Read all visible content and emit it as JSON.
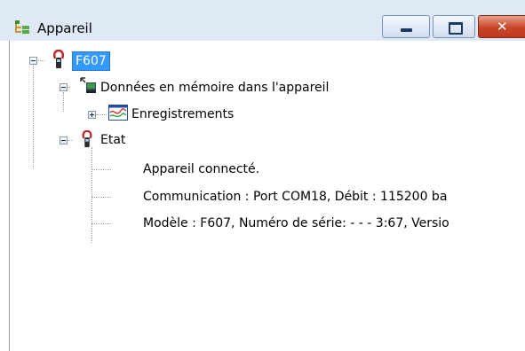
{
  "window": {
    "title": "Appareil",
    "icons": {
      "app": "tree-icon",
      "minimize": "minimize-icon",
      "maximize": "maximize-icon",
      "close": "close-icon"
    },
    "close_glyph": "✕"
  },
  "tree": {
    "root": {
      "label": "F607",
      "icon": "clamp-meter-icon",
      "expanded": true,
      "selected": true
    },
    "memory": {
      "label": "Données en mémoire dans l'appareil",
      "icon": "device-memory-icon",
      "expanded": true
    },
    "recordings": {
      "label": "Enregistrements",
      "icon": "chart-icon",
      "expanded": false
    },
    "state": {
      "label": "Etat",
      "icon": "clamp-meter-icon",
      "expanded": true
    },
    "state_items": [
      "Appareil connecté.",
      "Communication : Port COM18, Débit : 115200 ba",
      "Modèle : F607, Numéro de série: - - - 3:67, Versio"
    ]
  },
  "colors": {
    "selection": "#3399ff",
    "titlebar": "#dfe9f5",
    "close_button": "#c8452a"
  }
}
